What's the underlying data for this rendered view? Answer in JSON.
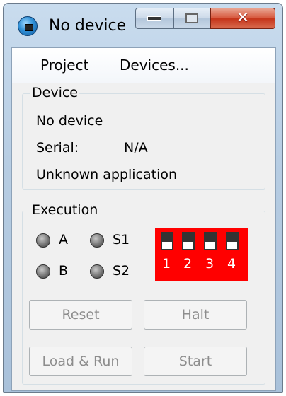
{
  "window": {
    "title": "No device"
  },
  "menu": {
    "project": "Project",
    "devices": "Devices..."
  },
  "device_group": {
    "title": "Device",
    "status": "No device",
    "serial_label": "Serial:",
    "serial_value": "N/A",
    "application": "Unknown application"
  },
  "execution_group": {
    "title": "Execution",
    "indicators": [
      "A",
      "S1",
      "B",
      "S2"
    ],
    "switch_labels": [
      "1",
      "2",
      "3",
      "4"
    ],
    "switch_color": "#ff0000"
  },
  "buttons": {
    "reset": "Reset",
    "halt": "Halt",
    "load_run": "Load & Run",
    "start": "Start"
  }
}
